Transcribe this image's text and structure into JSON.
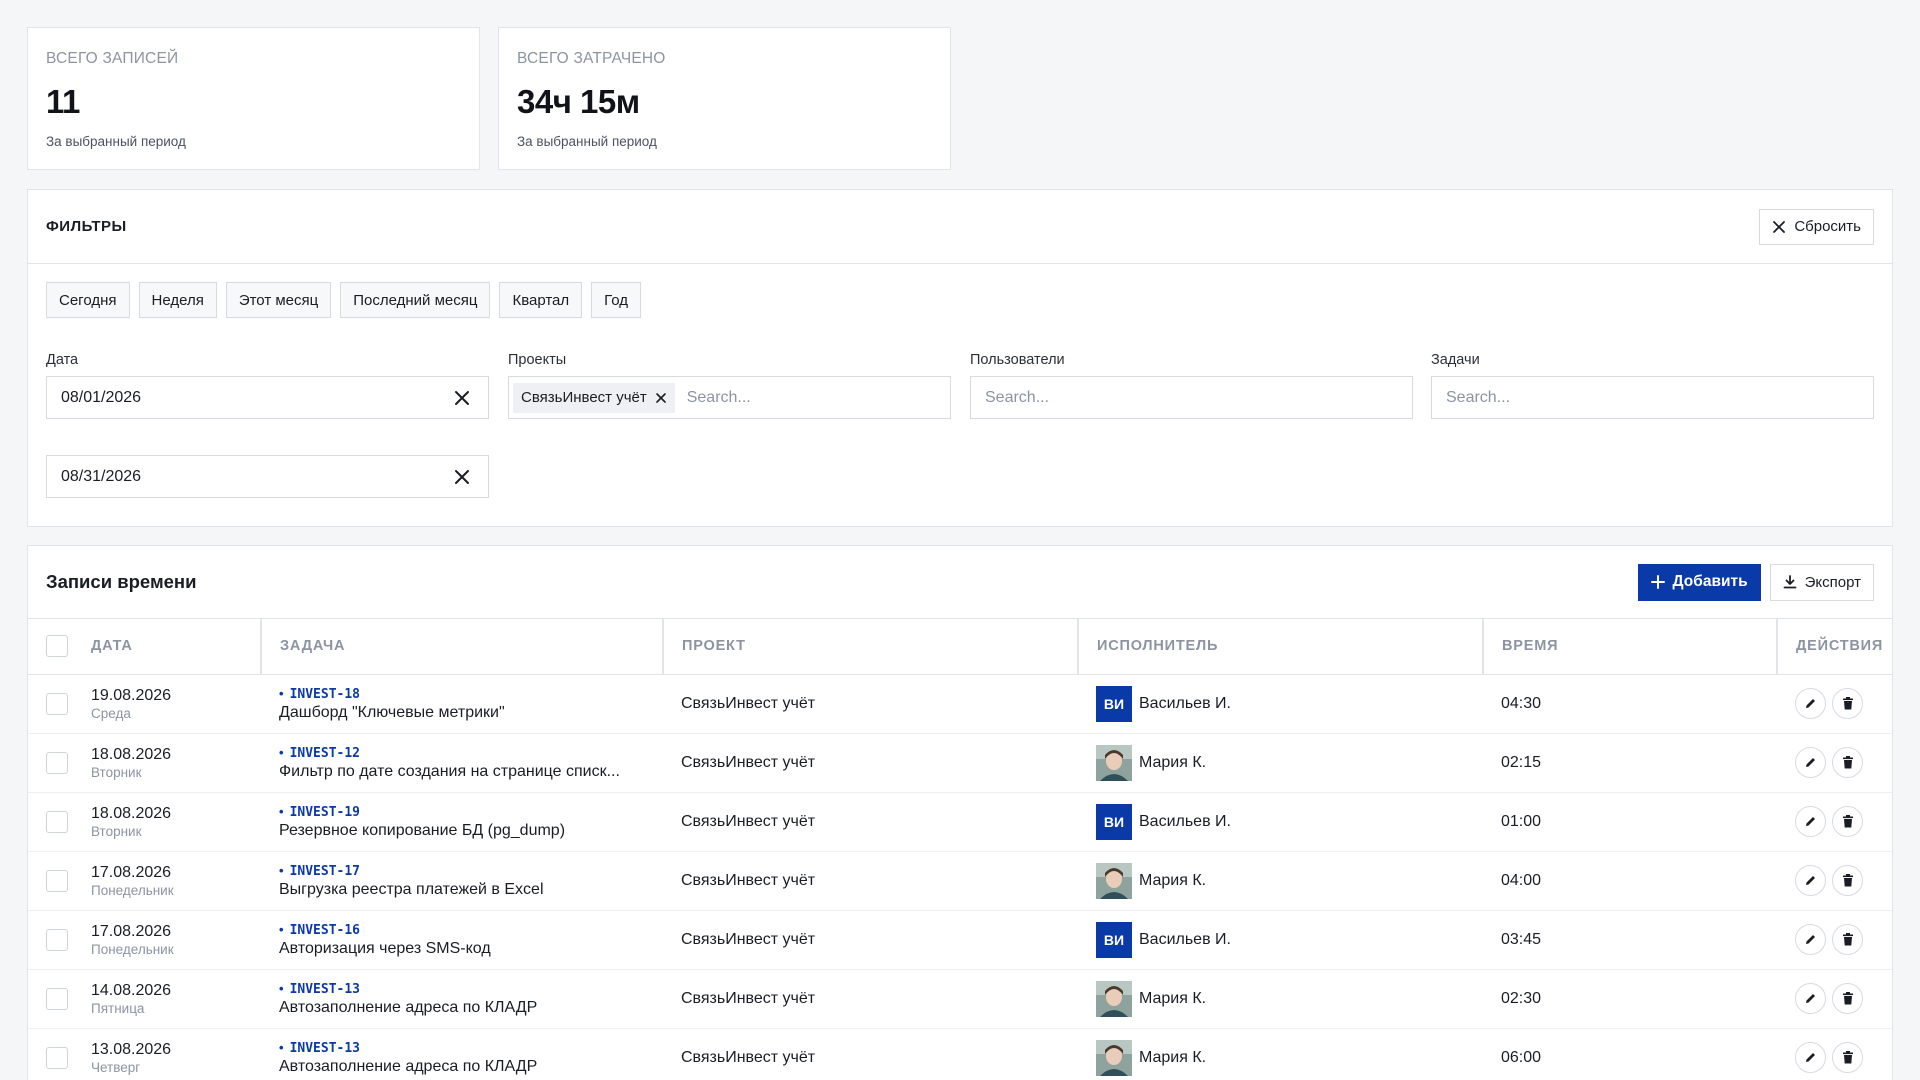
{
  "stats": {
    "total_entries": {
      "label": "ВСЕГО ЗАПИСЕЙ",
      "value": "11",
      "sub": "За выбранный период"
    },
    "total_spent": {
      "label": "ВСЕГО ЗАТРАЧЕНО",
      "value": "34ч 15м",
      "sub": "За выбранный период"
    }
  },
  "filters": {
    "title": "ФИЛЬТРЫ",
    "reset_label": "Сбросить",
    "presets": [
      "Сегодня",
      "Неделя",
      "Этот месяц",
      "Последний месяц",
      "Квартал",
      "Год"
    ],
    "date_label": "Дата",
    "date_from": "08/01/2026",
    "date_to": "08/31/2026",
    "projects_label": "Проекты",
    "projects_chip": "СвязьИнвест учёт",
    "projects_placeholder": "Search...",
    "users_label": "Пользователи",
    "users_placeholder": "Search...",
    "tasks_label": "Задачи",
    "tasks_placeholder": "Search..."
  },
  "entries": {
    "title": "Записи времени",
    "add_label": "Добавить",
    "export_label": "Экспорт",
    "columns": [
      "ДАТА",
      "ЗАДАЧА",
      "ПРОЕКТ",
      "ИСПОЛНИТЕЛЬ",
      "ВРЕМЯ",
      "ДЕЙСТВИЯ"
    ],
    "rows": [
      {
        "date": "19.08.2026",
        "weekday": "Среда",
        "key": "INVEST-18",
        "task": "Дашборд \"Ключевые метрики\"",
        "project": "СвязьИнвест учёт",
        "avatar": "ВИ",
        "assignee": "Васильев И.",
        "time": "04:30"
      },
      {
        "date": "18.08.2026",
        "weekday": "Вторник",
        "key": "INVEST-12",
        "task": "Фильтр по дате создания на странице списк...",
        "project": "СвязьИнвест учёт",
        "avatar": "photo",
        "assignee": "Мария К.",
        "time": "02:15"
      },
      {
        "date": "18.08.2026",
        "weekday": "Вторник",
        "key": "INVEST-19",
        "task": "Резервное копирование БД (pg_dump)",
        "project": "СвязьИнвест учёт",
        "avatar": "ВИ",
        "assignee": "Васильев И.",
        "time": "01:00"
      },
      {
        "date": "17.08.2026",
        "weekday": "Понедельник",
        "key": "INVEST-17",
        "task": "Выгрузка реестра платежей в Excel",
        "project": "СвязьИнвест учёт",
        "avatar": "photo",
        "assignee": "Мария К.",
        "time": "04:00"
      },
      {
        "date": "17.08.2026",
        "weekday": "Понедельник",
        "key": "INVEST-16",
        "task": "Авторизация через SMS-код",
        "project": "СвязьИнвест учёт",
        "avatar": "ВИ",
        "assignee": "Васильев И.",
        "time": "03:45"
      },
      {
        "date": "14.08.2026",
        "weekday": "Пятница",
        "key": "INVEST-13",
        "task": "Автозаполнение адреса по КЛАДР",
        "project": "СвязьИнвест учёт",
        "avatar": "photo",
        "assignee": "Мария К.",
        "time": "02:30"
      },
      {
        "date": "13.08.2026",
        "weekday": "Четверг",
        "key": "INVEST-13",
        "task": "Автозаполнение адреса по КЛАДР",
        "project": "СвязьИнвест учёт",
        "avatar": "photo",
        "assignee": "Мария К.",
        "time": "06:00"
      }
    ]
  },
  "colors": {
    "primary": "#0a3aa8",
    "border": "#e1e4e9",
    "muted": "#8c94a3",
    "background": "#f5f6f8"
  }
}
